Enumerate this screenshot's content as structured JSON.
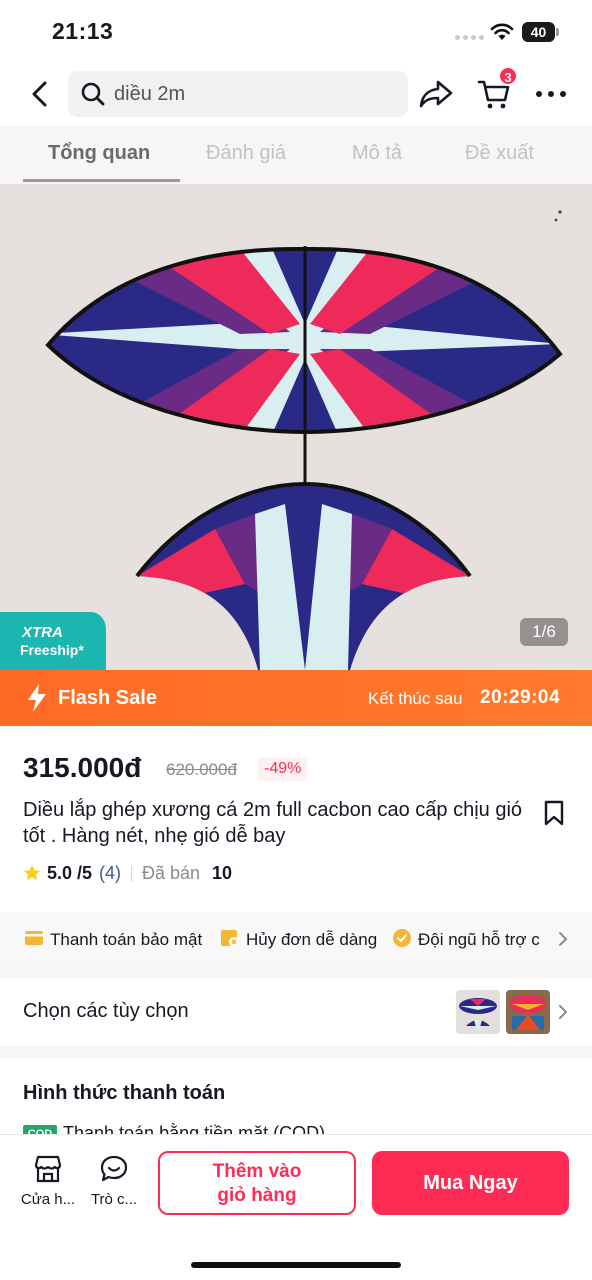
{
  "status_bar": {
    "time": "21:13",
    "battery": "40"
  },
  "nav": {
    "search_text": "diều 2m",
    "cart_badge": "3",
    "icons": [
      "back-arrow-icon",
      "search-icon",
      "share-icon",
      "cart-icon",
      "more-icon"
    ]
  },
  "tabs": [
    {
      "label": "Tổng quan",
      "active": true
    },
    {
      "label": "Đánh giá",
      "active": false
    },
    {
      "label": "Mô tả",
      "active": false
    },
    {
      "label": "Đề xuất",
      "active": false
    }
  ],
  "gallery": {
    "xtra_title": "XTRA",
    "xtra_subtitle": "Freeship*",
    "counter": "1/6"
  },
  "flash_sale": {
    "label": "Flash Sale",
    "ends_label": "Kết thúc sau",
    "timer": "20:29:04",
    "color": "#ff6a25"
  },
  "product": {
    "price": "315.000đ",
    "original_price": "620.000đ",
    "discount": "-49%",
    "title": "Diều lắp ghép xương cá 2m full cacbon cao cấp chịu gió tốt . Hàng nét, nhẹ gió dễ bay",
    "rating": "5.0 /5",
    "rating_count": "(4)",
    "sold_label": "Đã bán",
    "sold_count": "10"
  },
  "assurances": [
    {
      "label": "Thanh toán bảo mật",
      "icon": "card-icon"
    },
    {
      "label": "Hủy đơn dễ dàng",
      "icon": "cancel-order-icon"
    },
    {
      "label": "Đội ngũ hỗ trợ c",
      "icon": "check-badge-icon"
    }
  ],
  "options": {
    "label": "Chọn các tùy chọn"
  },
  "payment": {
    "title": "Hình thức thanh toán",
    "cod_badge": "COD",
    "method": "Thanh toán bằng tiền mặt (COD)"
  },
  "bottom_bar": {
    "shop_label": "Cửa h...",
    "chat_label": "Trò c...",
    "add_to_cart": [
      "Thêm vào",
      "giỏ hàng"
    ],
    "buy_now": "Mua Ngay",
    "accent": "#fe2c55"
  }
}
